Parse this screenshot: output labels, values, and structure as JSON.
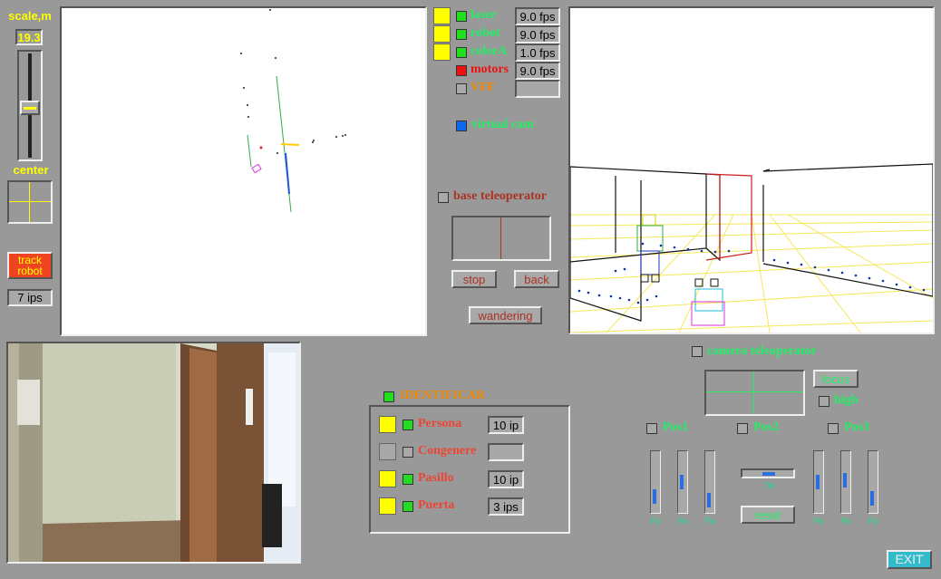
{
  "colors": {
    "background": "#999999",
    "accent_yellow": "#ffff00",
    "label_green": "#22ee66",
    "label_red": "#cc3333",
    "label_orange": "#ee8800",
    "track_button": "#ee4422",
    "exit_button": "#33bbcc"
  },
  "left_column": {
    "scale_label": "scale,m",
    "scale_value": "19.3",
    "scale_slider_position": 0.5,
    "center_label": "center",
    "track_robot_label": "track\nrobot",
    "ips_label": "7 ips"
  },
  "sensors": [
    {
      "name": "laser",
      "color": "#22ee66",
      "enabled": true,
      "shown": true,
      "fps": "9.0 fps",
      "icon": "green-checkbox"
    },
    {
      "name": "robot",
      "color": "#22ee66",
      "enabled": true,
      "shown": true,
      "fps": "9.0 fps",
      "icon": "green-checkbox"
    },
    {
      "name": "colorA",
      "color": "#22ee66",
      "enabled": true,
      "shown": true,
      "fps": "1.0 fps",
      "icon": "green-checkbox"
    },
    {
      "name": "motors",
      "color": "#ee1111",
      "enabled": false,
      "shown": true,
      "fps": "9.0 fps",
      "icon": "red-checkbox"
    },
    {
      "name": "VFF",
      "color": "#ee8800",
      "enabled": false,
      "shown": false,
      "fps": "",
      "icon": "empty-checkbox"
    }
  ],
  "virtual_cam": {
    "label": "virtual cam",
    "icon": "blue-checkbox"
  },
  "base_teleoperator": {
    "label": "base teleoperator",
    "stop_label": "stop",
    "back_label": "back",
    "wandering_label": "wandering"
  },
  "identificar": {
    "title": "IDENTIFICAR",
    "items": [
      {
        "name": "Persona",
        "active": true,
        "rate": "10 ip"
      },
      {
        "name": "Congenere",
        "active": false,
        "rate": ""
      },
      {
        "name": "Pasillo",
        "active": true,
        "rate": "10 ip"
      },
      {
        "name": "Puerta",
        "active": true,
        "rate": "3 ips"
      }
    ]
  },
  "camera_teleoperator": {
    "label": "camera teleoperator",
    "focus_label": "focus",
    "high_label": "high",
    "pos_labels": [
      "Pos1",
      "Pos2",
      "Pos3"
    ],
    "reset_label": "reset",
    "slider_labels": [
      "Pa",
      "Pa",
      "Pa",
      "Pa",
      "Pa",
      "Pa"
    ],
    "slider_values": [
      0.25,
      0.5,
      0.15,
      0.3,
      0.55,
      0.7
    ],
    "hslider_label": "Tilt",
    "hslider_value": 0.45
  },
  "exit_label": "EXIT"
}
